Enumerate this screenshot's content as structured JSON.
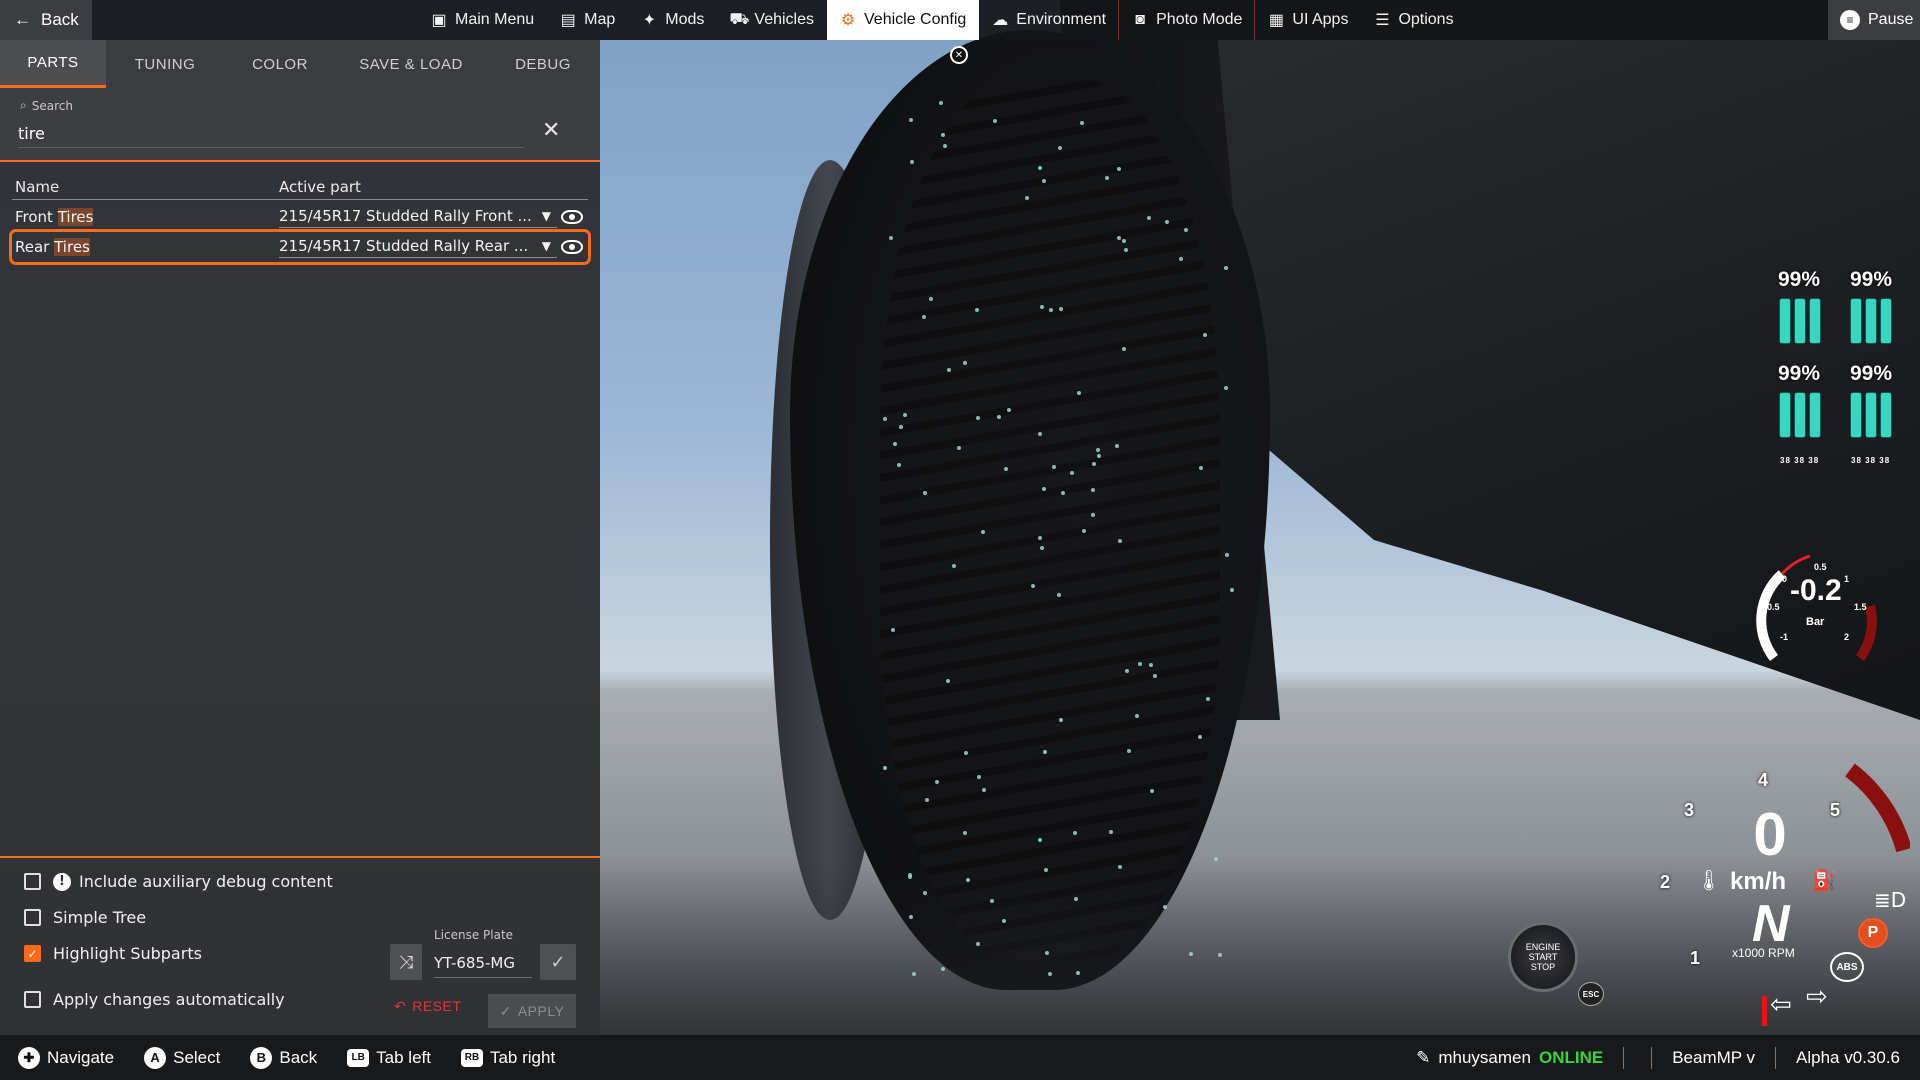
{
  "topbar": {
    "back_label": "Back",
    "menu": [
      {
        "label": "Main Menu",
        "icon": "main-menu-icon"
      },
      {
        "label": "Map",
        "icon": "map-icon"
      },
      {
        "label": "Mods",
        "icon": "puzzle-icon"
      },
      {
        "label": "Vehicles",
        "icon": "car-icon"
      },
      {
        "label": "Vehicle Config",
        "icon": "engine-icon",
        "active": true
      },
      {
        "label": "Environment",
        "icon": "weather-icon"
      },
      {
        "label": "Photo Mode",
        "icon": "camera-icon"
      },
      {
        "label": "UI Apps",
        "icon": "ui-apps-icon"
      },
      {
        "label": "Options",
        "icon": "sliders-icon"
      }
    ],
    "pause_label": "Pause"
  },
  "panel": {
    "tabs": [
      "PARTS",
      "TUNING",
      "COLOR",
      "SAVE & LOAD",
      "DEBUG"
    ],
    "active_tab": "PARTS",
    "search": {
      "label": "Search",
      "value": "tire"
    },
    "table": {
      "headers": {
        "name": "Name",
        "active_part": "Active part"
      },
      "rows": [
        {
          "name_pre": "Front ",
          "name_hl": "Tires",
          "part": "215/45R17 Studded Rally Front ...",
          "selected": false
        },
        {
          "name_pre": "Rear ",
          "name_hl": "Tires",
          "part": "215/45R17 Studded Rally Rear ...",
          "selected": true
        }
      ]
    },
    "options": {
      "aux_debug": {
        "label": "Include auxiliary debug content",
        "checked": false
      },
      "simple_tree": {
        "label": "Simple Tree",
        "checked": false
      },
      "highlight_subparts": {
        "label": "Highlight Subparts",
        "checked": true
      },
      "apply_auto": {
        "label": "Apply changes automatically",
        "checked": false
      }
    },
    "license_plate": {
      "label": "License Plate",
      "value": "YT-685-MG"
    },
    "reset_label": "RESET",
    "apply_label": "APPLY"
  },
  "bottombar": {
    "hints": [
      {
        "key": "✚",
        "label": "Navigate",
        "icon": "dpad-icon"
      },
      {
        "key": "A",
        "label": "Select",
        "icon": "a-button-icon"
      },
      {
        "key": "B",
        "label": "Back",
        "icon": "b-button-icon"
      },
      {
        "key": "LB",
        "label": "Tab left",
        "icon": "lb-button-icon"
      },
      {
        "key": "RB",
        "label": "Tab right",
        "icon": "rb-button-icon"
      }
    ],
    "username": "mhuysamen",
    "online_status": "ONLINE",
    "mp_label": "BeamMP v",
    "version": "Alpha v0.30.6"
  },
  "hud": {
    "tire_wear": [
      "99%",
      "99%",
      "99%",
      "99%"
    ],
    "tire_temps": "38 38 38",
    "boost": {
      "value": "-0.2",
      "unit": "Bar",
      "ticks": [
        "0",
        "0.5",
        "1",
        "-0.5",
        "1.5",
        "-1",
        "2"
      ]
    },
    "speed": {
      "value": "0",
      "unit": "km/h"
    },
    "gear": "N",
    "rpm_unit": "x1000 RPM",
    "rpm_marks": [
      "1",
      "2",
      "3",
      "4",
      "5"
    ],
    "engine_button": "ENGINE START STOP",
    "esc_label": "ESC",
    "parking_label": "P",
    "abs_label": "ABS"
  },
  "colors": {
    "accent": "#ff6a1a",
    "online": "#3ad43a",
    "tire_ok": "#38d8c0"
  }
}
